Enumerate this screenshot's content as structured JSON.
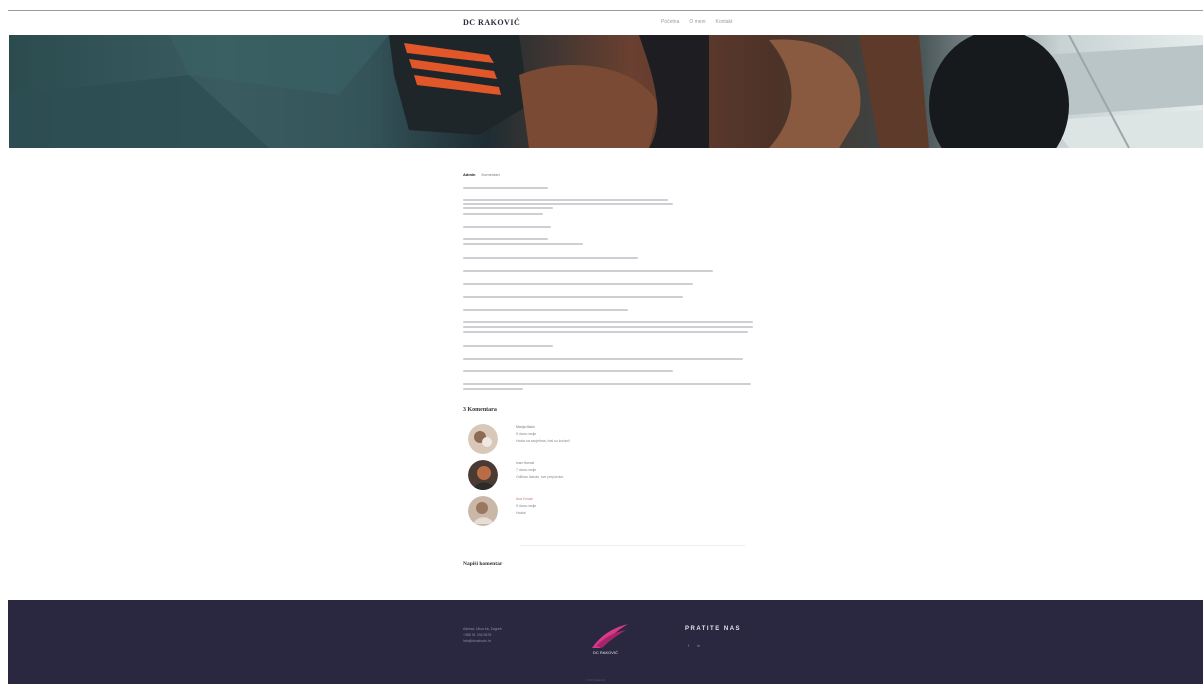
{
  "nav": {
    "brand": "DC RAKOVIĆ",
    "links": [
      "Početna",
      "O meni",
      "Kontakt"
    ]
  },
  "post": {
    "tabs": [
      "Admin",
      "Komentari"
    ]
  },
  "comments": {
    "title": "3 Komentara",
    "items": [
      {
        "name": "Marija Marić",
        "date": "5 dana ranije",
        "text": "Hvala na savjetima, baš su korisni!"
      },
      {
        "name": "Ivan Horvat",
        "date": "7 dana ranije",
        "text": "Odličan članak, sve preporuke."
      },
      {
        "name": "Ana Kovač",
        "date": "9 dana ranije",
        "text": "Hvala!"
      }
    ]
  },
  "reply": {
    "title": "Napiši komentar"
  },
  "footer": {
    "contact": [
      "Adresa: Ulica bb, Zagreb",
      "+385 91 234 5678",
      "info@dcrakovic.hr"
    ],
    "logo_text": "DC RAKOVIĆ",
    "follow": "PRATITE NAS",
    "social": [
      "f",
      "in"
    ],
    "copyright": "© DC Raković"
  },
  "colors": {
    "footer_bg": "#2a2740",
    "logo_accent": "#d63a8a"
  }
}
